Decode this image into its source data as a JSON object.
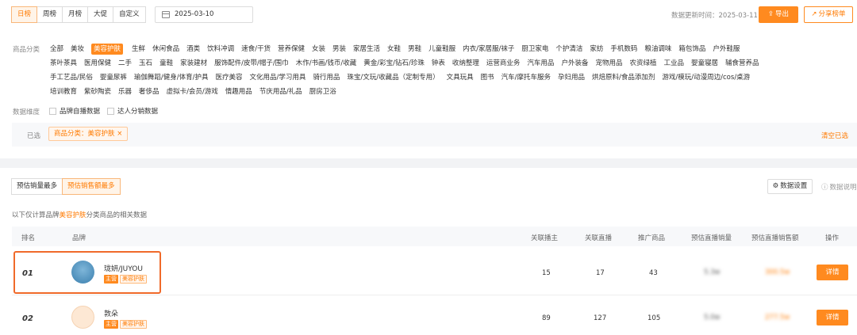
{
  "period_tabs": [
    "日榜",
    "周榜",
    "月榜",
    "大促",
    "自定义"
  ],
  "date_value": "2025-03-10",
  "update_time": "数据更新时间：2025-03-11",
  "export_label": "导出",
  "share_label": "分享榜单",
  "category_label": "商品分类",
  "category_rows": [
    [
      "全部",
      "美妆",
      "美容护肤",
      "生鲜",
      "休闲食品",
      "酒类",
      "饮料冲调",
      "速食/干货",
      "营养保健",
      "女装",
      "男装",
      "家居生活",
      "女鞋",
      "男鞋",
      "儿童鞋服",
      "内衣/家居服/袜子",
      "厨卫家电",
      "个护清洁",
      "家纺",
      "手机数码",
      "粮油调味",
      "箱包饰品",
      "户外鞋服"
    ],
    [
      "茶叶茶具",
      "医用保健",
      "二手",
      "玉石",
      "童鞋",
      "家装建材",
      "服饰配件/皮带/帽子/围巾",
      "木作/书画/钱币/收藏",
      "黄金/彩宝/钻石/珍珠",
      "钟表",
      "收纳整理",
      "运营商业务",
      "汽车用品",
      "户外装备",
      "宠物用品",
      "农资绿植",
      "工业品",
      "婴童寝居",
      "辅食营养品"
    ],
    [
      "手工艺品/民俗",
      "婴童尿裤",
      "瑜伽舞蹈/健身/体育/护具",
      "医疗美容",
      "文化用品/学习用具",
      "骑行用品",
      "珠宝/文玩/收藏品（定制专用）",
      "文具玩具",
      "图书",
      "汽车/摩托车服务",
      "孕妇用品",
      "烘焙原料/食品添加剂",
      "游戏/模玩/动漫周边/cos/桌游"
    ],
    [
      "培训教育",
      "紫砂陶瓷",
      "乐器",
      "奢侈品",
      "虚拟卡/会员/游戏",
      "情趣用品",
      "节庆用品/礼品",
      "厨房卫浴"
    ]
  ],
  "active_category": "美容护肤",
  "dimension_label": "数据维度",
  "dimension_options": [
    "品牌自播数据",
    "达人分销数据"
  ],
  "selected_label": "已选",
  "selected_tag": "商品分类：美容护肤",
  "clear_label": "清空已选",
  "sort_tabs": [
    "预估销量最多",
    "预估销售额最多"
  ],
  "data_settings": "数据设置",
  "data_explain": "数据说明",
  "note_prefix": "以下仅计算品牌",
  "note_highlight": "美容护肤",
  "note_suffix": "分类商品的相关数据",
  "columns": [
    "排名",
    "品牌",
    "关联播主",
    "关联直播",
    "推广商品",
    "预估直播销量",
    "预估直播销售额",
    "操作"
  ],
  "rows": [
    {
      "rank": "01",
      "brand": "珑妍/JUYOU",
      "tag_main": "主营",
      "tag_cat": "美容护肤",
      "anchors": "15",
      "lives": "17",
      "products": "43",
      "sales_vol": "5.3w",
      "sales_amt": "300.5w",
      "action": "详情"
    },
    {
      "rank": "02",
      "brand": "敦朵",
      "tag_main": "主营",
      "tag_cat": "美容护肤",
      "anchors": "89",
      "lives": "127",
      "products": "105",
      "sales_vol": "5.0w",
      "sales_amt": "277.5w",
      "action": "详情"
    }
  ],
  "colors": {
    "accent": "#ff8a1f",
    "highlight_border": "#f06a2a"
  },
  "icons": [
    "calendar-icon",
    "export-icon",
    "share-icon",
    "settings-icon",
    "info-icon"
  ]
}
